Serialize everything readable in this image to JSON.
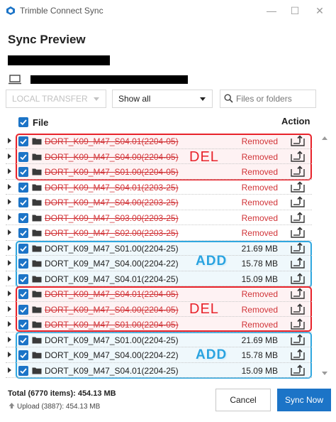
{
  "window": {
    "title": "Trimble Connect Sync",
    "minimize_glyph": "—",
    "maximize_glyph": "☐",
    "close_glyph": "✕"
  },
  "page": {
    "heading": "Sync Preview"
  },
  "filters": {
    "transfer": "LOCAL TRANSFER",
    "show": "Show all",
    "search_placeholder": "Files or folders"
  },
  "table": {
    "col_file": "File",
    "col_action": "Action",
    "rows": [
      {
        "name": "DORT_K09_M47_S04.01(2204-05)",
        "status": "Removed",
        "type": "removed"
      },
      {
        "name": "DORT_K09_M47_S04.00(2204-05)",
        "status": "Removed",
        "type": "removed"
      },
      {
        "name": "DORT_K09_M47_S01.00(2204-05)",
        "status": "Removed",
        "type": "removed"
      },
      {
        "name": "DORT_K09_M47_S04.01(2203-25)",
        "status": "Removed",
        "type": "removed"
      },
      {
        "name": "DORT_K09_M47_S04.00(2203-25)",
        "status": "Removed",
        "type": "removed"
      },
      {
        "name": "DORT_K09_M47_S03.00(2203-25)",
        "status": "Removed",
        "type": "removed"
      },
      {
        "name": "DORT_K09_M47_S02.00(2203-25)",
        "status": "Removed",
        "type": "removed"
      },
      {
        "name": "DORT_K09_M47_S01.00(2204-25)",
        "status": "21.69 MB",
        "type": "added"
      },
      {
        "name": "DORT_K09_M47_S04.00(2204-22)",
        "status": "15.78 MB",
        "type": "added"
      },
      {
        "name": "DORT_K09_M47_S04.01(2204-25)",
        "status": "15.09 MB",
        "type": "added"
      },
      {
        "name": "DORT_K09_M47_S04.01(2204-05)",
        "status": "Removed",
        "type": "removed"
      },
      {
        "name": "DORT_K09_M47_S04.00(2204-05)",
        "status": "Removed",
        "type": "removed"
      },
      {
        "name": "DORT_K09_M47_S01.00(2204-05)",
        "status": "Removed",
        "type": "removed"
      },
      {
        "name": "DORT_K09_M47_S01.00(2204-25)",
        "status": "21.69 MB",
        "type": "added"
      },
      {
        "name": "DORT_K09_M47_S04.00(2204-22)",
        "status": "15.78 MB",
        "type": "added"
      },
      {
        "name": "DORT_K09_M47_S04.01(2204-25)",
        "status": "15.09 MB",
        "type": "added"
      }
    ]
  },
  "annotations": {
    "del_label": "DEL",
    "add_label": "ADD",
    "del_color": "#e8232b",
    "add_color": "#31a7df"
  },
  "footer": {
    "total": "Total (6770 items): 454.13 MB",
    "upload": "Upload (3887): 454.13 MB",
    "cancel": "Cancel",
    "sync": "Sync Now"
  },
  "colors": {
    "accent": "#1c74c7",
    "removed": "#d13438"
  },
  "icons": {
    "app": "trimble-logo-icon",
    "device": "laptop-icon",
    "search": "search-icon",
    "folder": "folder-icon",
    "action": "upload-icon",
    "upload": "upload-arrow-icon"
  }
}
